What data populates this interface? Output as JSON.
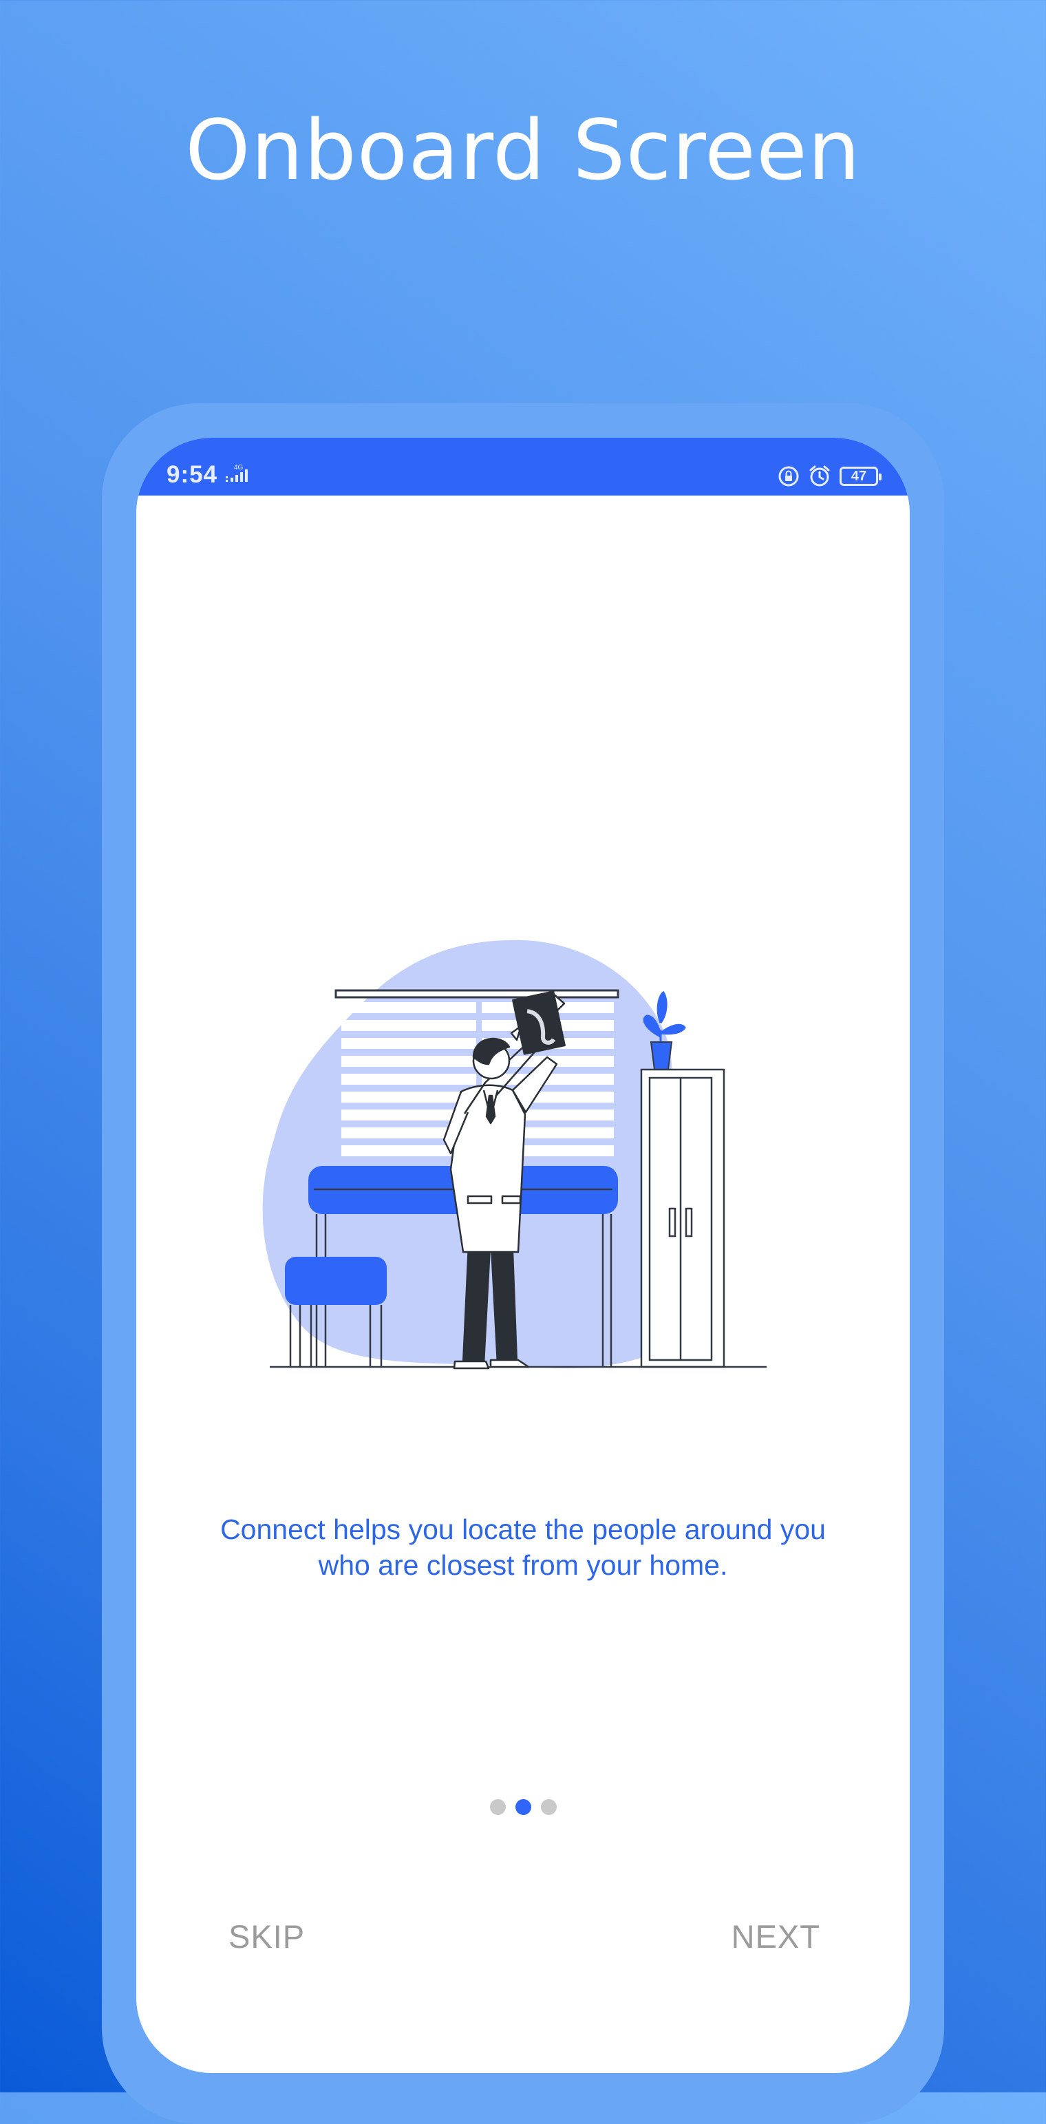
{
  "heading": "Onboard Screen",
  "status_bar": {
    "time": "9:54",
    "network": "4G",
    "battery": "47",
    "icons": [
      "signal-icon",
      "lock-rotation-icon",
      "alarm-icon",
      "battery-icon"
    ]
  },
  "onboarding": {
    "description": "Connect helps you locate the people around you who are closest from your home.",
    "page_count": 3,
    "active_page": 2,
    "skip_label": "SKIP",
    "next_label": "NEXT"
  },
  "colors": {
    "accent": "#2f66f7",
    "text_accent": "#2d66e6",
    "blob": "#c3cffb",
    "inactive_dot": "#c9c9c9",
    "button_text": "#9b9b9b"
  }
}
